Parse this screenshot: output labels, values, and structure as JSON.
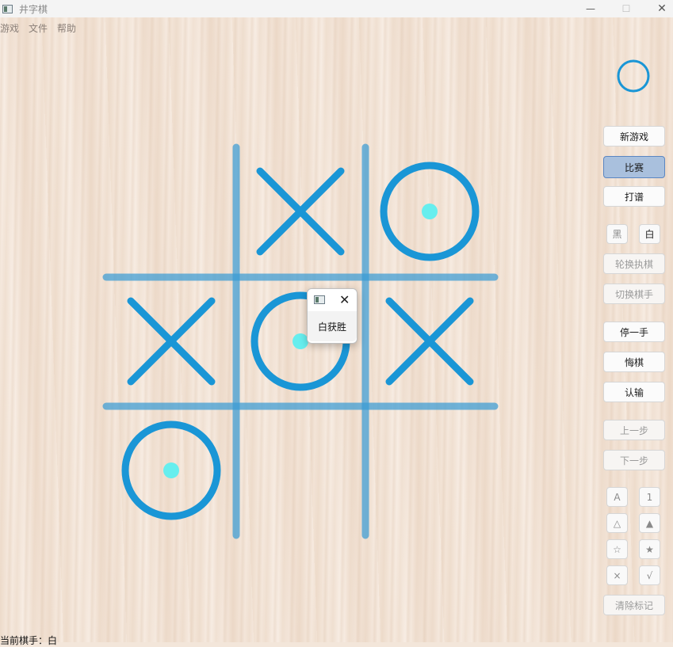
{
  "window": {
    "title": "井字棋",
    "minimize_glyph": "—",
    "maximize_glyph": "☐",
    "close_glyph": "✕"
  },
  "menu": [
    "游戏",
    "文件",
    "帮助"
  ],
  "board": {
    "cells": [
      [
        "",
        "X",
        "O"
      ],
      [
        "X",
        "O",
        "X"
      ],
      [
        "O",
        "",
        ""
      ]
    ],
    "last_move_marks": "cyan dots on O stones",
    "piece_color": "#1a96d6",
    "grid_color": "#3a9bd4",
    "dot_color": "#66eeee"
  },
  "turn_indicator": {
    "stone": "O"
  },
  "sidebar": {
    "new_game": "新游戏",
    "match": "比赛",
    "record": "打谱",
    "black": "黑",
    "white": "白",
    "rotate_holder": "轮换执棋",
    "switch_player": "切换棋手",
    "pass": "停一手",
    "undo": "悔棋",
    "resign": "认输",
    "prev_step": "上一步",
    "next_step": "下一步",
    "mark_a": "A",
    "mark_1": "1",
    "mark_triangle": "△",
    "mark_triangle_filled": "▲",
    "mark_star": "☆",
    "mark_star_filled": "★",
    "mark_x": "×",
    "mark_check": "√",
    "clear_marks": "清除标记"
  },
  "popup": {
    "close_glyph": "✕",
    "message": "白获胜"
  },
  "status": {
    "text": "当前棋手：白"
  }
}
